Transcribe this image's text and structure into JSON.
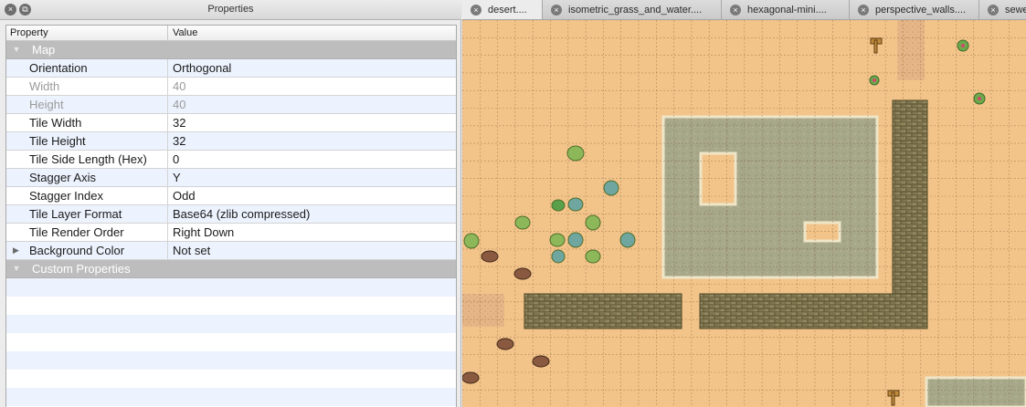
{
  "properties_panel": {
    "title": "Properties",
    "close_icon": "close-icon",
    "float_icon": "float-window-icon",
    "columns": {
      "property": "Property",
      "value": "Value"
    },
    "map_group": "Map",
    "rows": [
      {
        "name": "Orientation",
        "value": "Orthogonal",
        "disabled": false
      },
      {
        "name": "Width",
        "value": "40",
        "disabled": true
      },
      {
        "name": "Height",
        "value": "40",
        "disabled": true
      },
      {
        "name": "Tile Width",
        "value": "32",
        "disabled": false
      },
      {
        "name": "Tile Height",
        "value": "32",
        "disabled": false
      },
      {
        "name": "Tile Side Length (Hex)",
        "value": "0",
        "disabled": false
      },
      {
        "name": "Stagger Axis",
        "value": "Y",
        "disabled": false
      },
      {
        "name": "Stagger Index",
        "value": "Odd",
        "disabled": false
      },
      {
        "name": "Tile Layer Format",
        "value": "Base64 (zlib compressed)",
        "disabled": false
      },
      {
        "name": "Tile Render Order",
        "value": "Right Down",
        "disabled": false
      },
      {
        "name": "Background Color",
        "value": "Not set",
        "disabled": false,
        "expandable": true
      }
    ],
    "custom_group": "Custom Properties"
  },
  "tabs": [
    {
      "label": "desert....",
      "active": true
    },
    {
      "label": "isometric_grass_and_water....",
      "active": false
    },
    {
      "label": "hexagonal-mini....",
      "active": false
    },
    {
      "label": "perspective_walls....",
      "active": false
    },
    {
      "label": "sewe",
      "active": false
    }
  ],
  "colors": {
    "sand": "#f3c48a",
    "grid": "#7d5b39",
    "wall": "#7f7650",
    "floor": "#a9a98a",
    "group_header": "#bdbdbd",
    "alt_row": "#edf3fe"
  }
}
